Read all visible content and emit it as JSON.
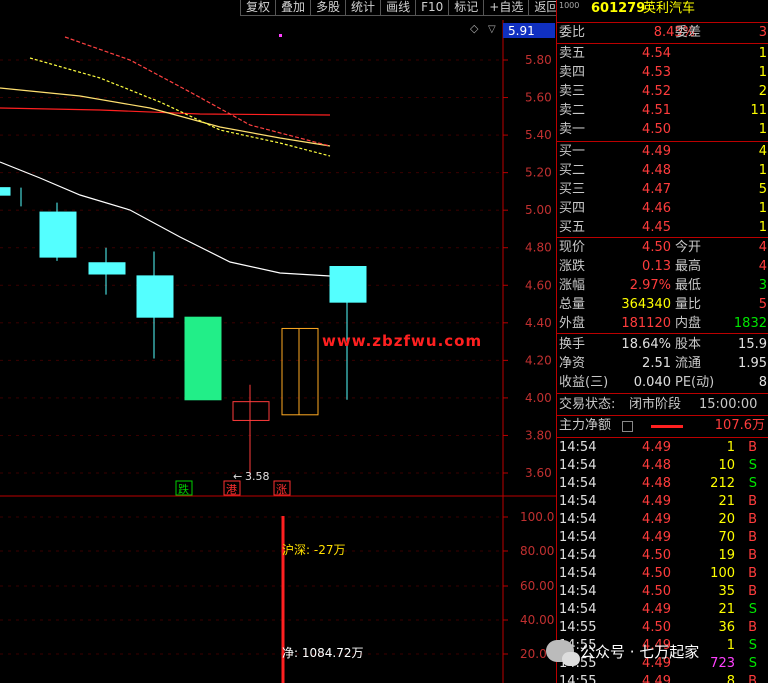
{
  "toolbar": {
    "items": [
      "复权",
      "叠加",
      "多股",
      "统计",
      "画线",
      "F10",
      "标记",
      "+自选",
      "返回"
    ]
  },
  "chart": {
    "current_price_tag": "5.91",
    "price_axis": [
      "5.80",
      "5.60",
      "5.40",
      "5.20",
      "5.00",
      "4.80",
      "4.60",
      "4.40",
      "4.20",
      "4.00",
      "3.80",
      "3.60"
    ],
    "low_label": "3.58",
    "tags": [
      {
        "text": "跌",
        "color": "#00d000"
      },
      {
        "text": "港",
        "color": "#ff3030"
      },
      {
        "text": "涨",
        "color": "#ff3030"
      }
    ],
    "volume_axis": [
      "100.0",
      "80.00",
      "60.00",
      "40.00",
      "20.00"
    ],
    "hushen_label": "沪深: -27万",
    "net_label": "净: 1084.72万",
    "watermark": "www.zbzfwu.com",
    "wechat_text": "公众号 · 七万起家",
    "chart_data": {
      "type": "candlestick",
      "ylim": [
        3.55,
        5.95
      ],
      "candles": [
        {
          "open": 5.08,
          "close": 5.12,
          "high": 5.12,
          "low": 5.02,
          "color": "#54ffff",
          "filled": true
        },
        {
          "open": 4.99,
          "close": 4.75,
          "high": 5.04,
          "low": 4.73,
          "color": "#54ffff",
          "filled": true
        },
        {
          "open": 4.72,
          "close": 4.66,
          "high": 4.8,
          "low": 4.55,
          "color": "#54ffff",
          "filled": true
        },
        {
          "open": 4.65,
          "close": 4.43,
          "high": 4.78,
          "low": 4.21,
          "color": "#54ffff",
          "filled": true
        },
        {
          "open": 4.43,
          "close": 3.99,
          "high": 4.43,
          "low": 3.99,
          "color": "#22ee88",
          "filled": true
        },
        {
          "open": 3.88,
          "close": 3.98,
          "high": 4.07,
          "low": 3.58,
          "color": "#ff3c3c",
          "filled": false
        },
        {
          "open": 3.91,
          "close": 4.37,
          "high": 4.37,
          "low": 3.91,
          "color": "#ffaa22",
          "filled": false
        },
        {
          "open": 4.7,
          "close": 4.51,
          "high": 4.7,
          "low": 3.99,
          "color": "#54ffff",
          "filled": true
        }
      ],
      "lines": [
        {
          "color": "#ffffff",
          "points": [
            [
              5.36,
              5.24
            ],
            [
              5.16
            ],
            [
              4.9,
              4.7
            ],
            [
              4.62
            ]
          ]
        },
        {
          "color": "#ff2020",
          "values": [
            5.48,
            5.47,
            5.46
          ]
        },
        {
          "color": "#ffe070",
          "values": [
            5.66,
            5.6,
            5.51,
            5.34
          ]
        },
        {
          "color": "#ffff40",
          "values": [
            5.85,
            5.66,
            5.44,
            5.29
          ]
        },
        {
          "color": "#ff4040",
          "values": [
            5.89,
            5.7,
            5.45,
            5.31
          ]
        }
      ]
    }
  },
  "panel": {
    "header": {
      "prefix": "1000",
      "code": "601279",
      "name": "英利汽车"
    },
    "weibi": {
      "label": "委比",
      "value": "8.45%",
      "label2": "委差",
      "value2": "3"
    },
    "sells": [
      {
        "label": "卖五",
        "price": "4.54",
        "vol": "1"
      },
      {
        "label": "卖四",
        "price": "4.53",
        "vol": "1"
      },
      {
        "label": "卖三",
        "price": "4.52",
        "vol": "2"
      },
      {
        "label": "卖二",
        "price": "4.51",
        "vol": "11"
      },
      {
        "label": "卖一",
        "price": "4.50",
        "vol": "1"
      }
    ],
    "buys": [
      {
        "label": "买一",
        "price": "4.49",
        "vol": "4"
      },
      {
        "label": "买二",
        "price": "4.48",
        "vol": "1"
      },
      {
        "label": "买三",
        "price": "4.47",
        "vol": "5"
      },
      {
        "label": "买四",
        "price": "4.46",
        "vol": "1"
      },
      {
        "label": "买五",
        "price": "4.45",
        "vol": "1"
      }
    ],
    "stats": [
      {
        "l1": "现价",
        "v1": "4.50",
        "c1": "red",
        "l2": "今开",
        "v2": "4",
        "c2": "red"
      },
      {
        "l1": "涨跌",
        "v1": "0.13",
        "c1": "red",
        "l2": "最高",
        "v2": "4",
        "c2": "red"
      },
      {
        "l1": "涨幅",
        "v1": "2.97%",
        "c1": "red",
        "l2": "最低",
        "v2": "3",
        "c2": "green"
      },
      {
        "l1": "总量",
        "v1": "364340",
        "c1": "yellow",
        "l2": "量比",
        "v2": "5",
        "c2": "red"
      },
      {
        "l1": "外盘",
        "v1": "181120",
        "c1": "red",
        "l2": "内盘",
        "v2": "1832",
        "c2": "green"
      }
    ],
    "stats2": [
      {
        "l1": "换手",
        "v1": "18.64%",
        "c1": "white",
        "l2": "股本",
        "v2": "15.9",
        "c2": "white"
      },
      {
        "l1": "净资",
        "v1": "2.51",
        "c1": "white",
        "l2": "流通",
        "v2": "1.95",
        "c2": "white"
      },
      {
        "l1": "收益(三)",
        "v1": "0.040",
        "c1": "white",
        "l2": "PE(动)",
        "v2": "8",
        "c2": "white"
      }
    ],
    "trade_status": {
      "label": "交易状态:",
      "value": "闭市阶段",
      "time": "15:00:00"
    },
    "main_force": {
      "label": "主力净额",
      "value": "107.6万"
    },
    "ticks": [
      {
        "time": "14:54",
        "price": "4.49",
        "vol": "1",
        "side": "B",
        "pc": "red",
        "vc": "yellow"
      },
      {
        "time": "14:54",
        "price": "4.48",
        "vol": "10",
        "side": "S",
        "pc": "red",
        "vc": "yellow"
      },
      {
        "time": "14:54",
        "price": "4.48",
        "vol": "212",
        "side": "S",
        "pc": "red",
        "vc": "yellow"
      },
      {
        "time": "14:54",
        "price": "4.49",
        "vol": "21",
        "side": "B",
        "pc": "red",
        "vc": "yellow"
      },
      {
        "time": "14:54",
        "price": "4.49",
        "vol": "20",
        "side": "B",
        "pc": "red",
        "vc": "yellow"
      },
      {
        "time": "14:54",
        "price": "4.49",
        "vol": "70",
        "side": "B",
        "pc": "red",
        "vc": "yellow"
      },
      {
        "time": "14:54",
        "price": "4.50",
        "vol": "19",
        "side": "B",
        "pc": "red",
        "vc": "yellow"
      },
      {
        "time": "14:54",
        "price": "4.50",
        "vol": "100",
        "side": "B",
        "pc": "red",
        "vc": "yellow"
      },
      {
        "time": "14:54",
        "price": "4.50",
        "vol": "35",
        "side": "B",
        "pc": "red",
        "vc": "yellow"
      },
      {
        "time": "14:54",
        "price": "4.49",
        "vol": "21",
        "side": "S",
        "pc": "red",
        "vc": "yellow"
      },
      {
        "time": "14:55",
        "price": "4.50",
        "vol": "36",
        "side": "B",
        "pc": "red",
        "vc": "yellow"
      },
      {
        "time": "14:55",
        "price": "4.49",
        "vol": "1",
        "side": "S",
        "pc": "red",
        "vc": "yellow"
      },
      {
        "time": "14:55",
        "price": "4.49",
        "vol": "723",
        "side": "S",
        "pc": "red",
        "vc": "magenta"
      },
      {
        "time": "14:55",
        "price": "4.49",
        "vol": "8",
        "side": "B",
        "pc": "red",
        "vc": "yellow"
      }
    ]
  }
}
